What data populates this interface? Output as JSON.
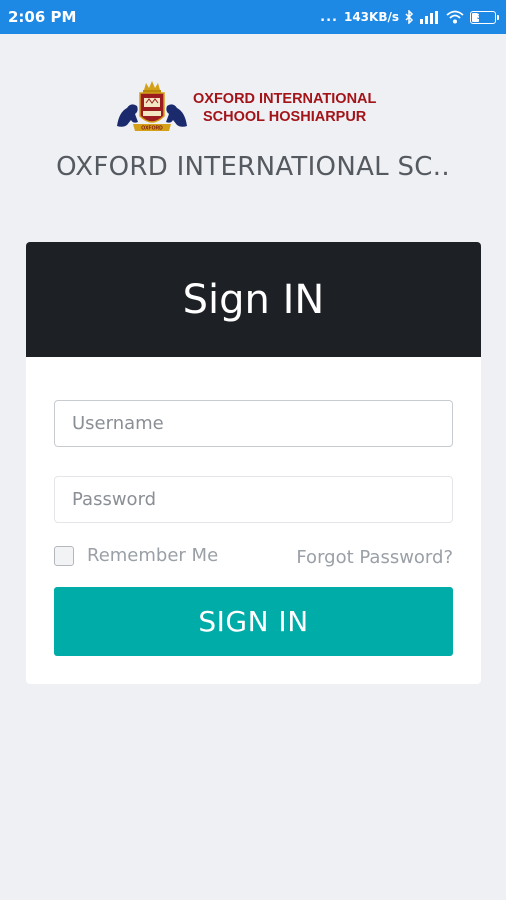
{
  "status_bar": {
    "time": "2:06 PM",
    "dots": "...",
    "network_speed": "143KB/s",
    "battery": "38",
    "icons": [
      "bluetooth-icon",
      "signal-icon",
      "wifi-icon",
      "battery-icon"
    ]
  },
  "logo": {
    "line1": "OXFORD INTERNATIONAL",
    "line2": "SCHOOL HOSHIARPUR",
    "crest_caption": "OXFORD"
  },
  "school_name": "OXFORD INTERNATIONAL SC..",
  "login": {
    "title": "Sign IN",
    "username_placeholder": "Username",
    "password_placeholder": "Password",
    "remember_label": "Remember Me",
    "remember_checked": false,
    "forgot_label": "Forgot Password?",
    "button_label": "SIGN IN"
  },
  "colors": {
    "status_bar": "#1e88e5",
    "header": "#1d2125",
    "button": "#00aca7",
    "logo_text": "#a31419"
  }
}
